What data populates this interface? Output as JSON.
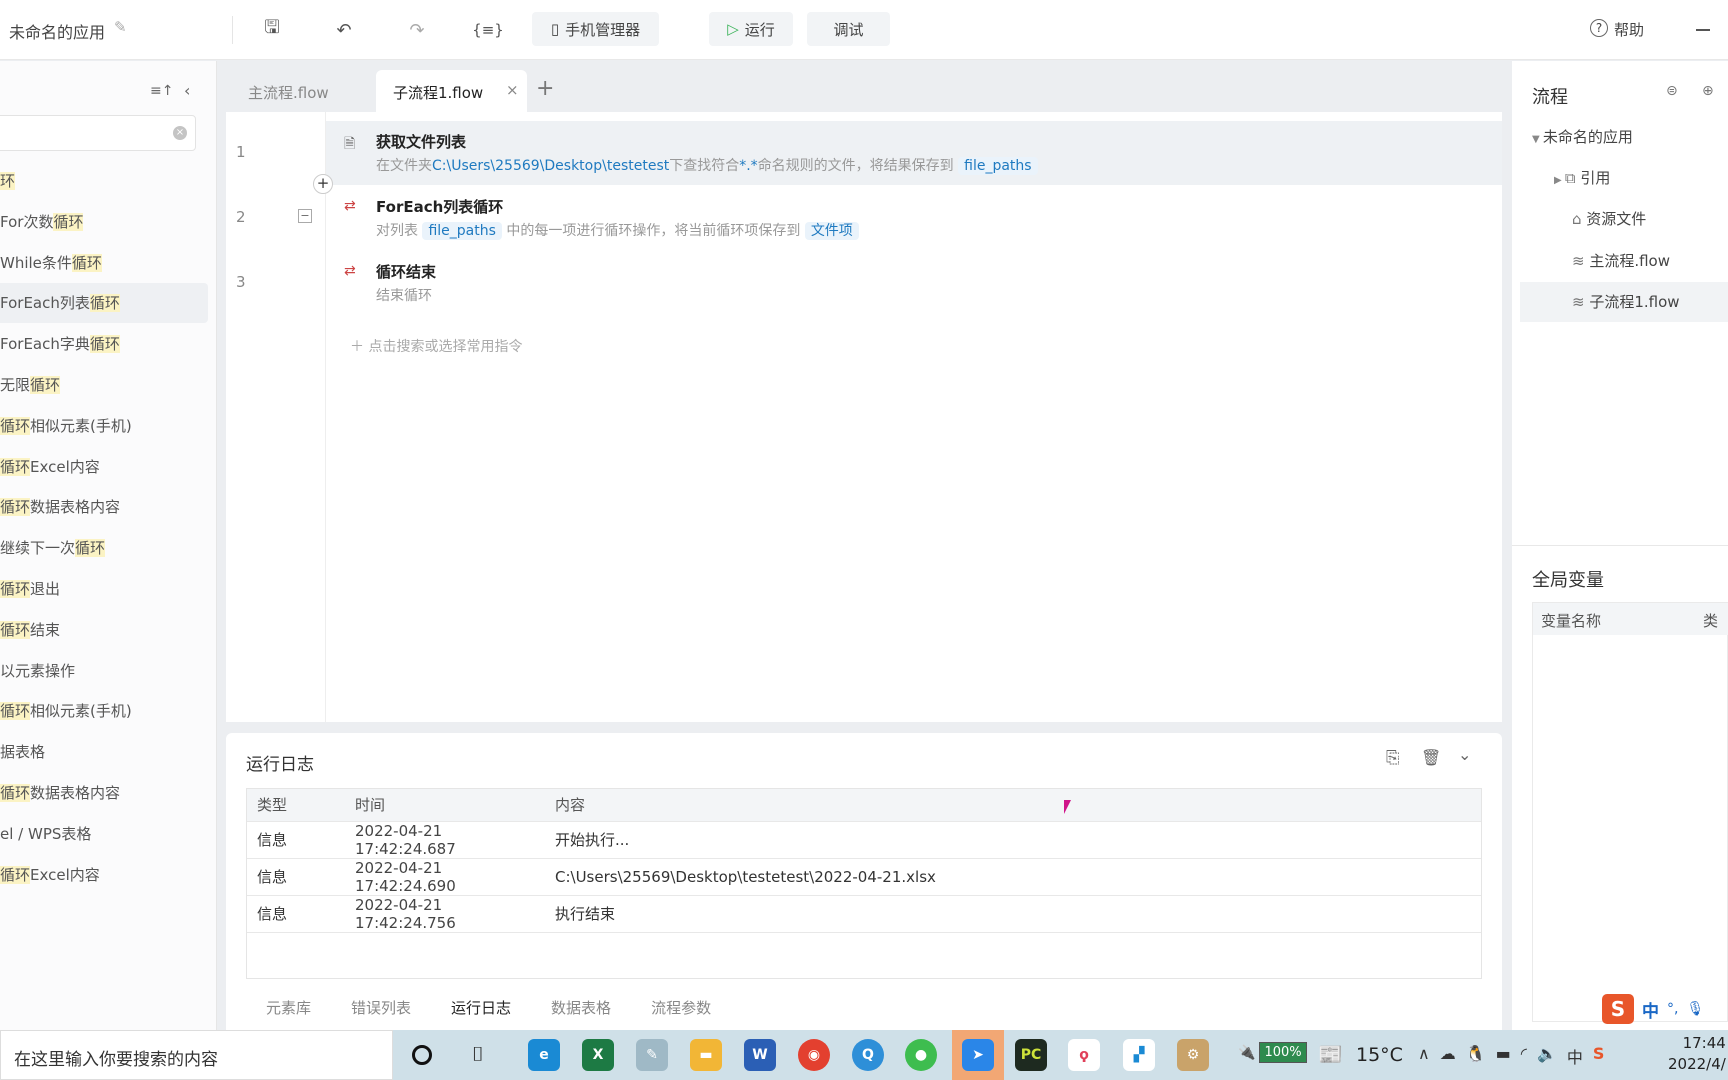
{
  "app": {
    "title": "未命名的应用"
  },
  "toolbar": {
    "phone_manager": "手机管理器",
    "run": "运行",
    "debug": "调试",
    "help": "帮助"
  },
  "left_panel": {
    "items": [
      {
        "pre": "",
        "hl": "环",
        "post": ""
      },
      {
        "pre": "For次数",
        "hl": "循环",
        "post": ""
      },
      {
        "pre": "While条件",
        "hl": "循环",
        "post": ""
      },
      {
        "pre": "ForEach列表",
        "hl": "循环",
        "post": ""
      },
      {
        "pre": "ForEach字典",
        "hl": "循环",
        "post": ""
      },
      {
        "pre": "无限",
        "hl": "循环",
        "post": ""
      },
      {
        "pre": "",
        "hl": "循环",
        "post": "相似元素(手机)"
      },
      {
        "pre": "",
        "hl": "循环",
        "post": "Excel内容"
      },
      {
        "pre": "",
        "hl": "循环",
        "post": "数据表格内容"
      },
      {
        "pre": "继续下一次",
        "hl": "循环",
        "post": ""
      },
      {
        "pre": "",
        "hl": "循环",
        "post": "退出"
      },
      {
        "pre": "",
        "hl": "循环",
        "post": "结束"
      },
      {
        "pre": "以元素操作",
        "hl": "",
        "post": ""
      },
      {
        "pre": "",
        "hl": "循环",
        "post": "相似元素(手机)"
      },
      {
        "pre": "据表格",
        "hl": "",
        "post": ""
      },
      {
        "pre": "",
        "hl": "循环",
        "post": "数据表格内容"
      },
      {
        "pre": "el / WPS表格",
        "hl": "",
        "post": ""
      },
      {
        "pre": "",
        "hl": "循环",
        "post": "Excel内容"
      }
    ]
  },
  "tabs": [
    {
      "label": "主流程.flow"
    },
    {
      "label": "子流程1.flow"
    }
  ],
  "editor": {
    "rows": [
      {
        "num": "1",
        "title": "获取文件列表",
        "d1": "在文件夹",
        "path": "C:\\Users\\25569\\Desktop\\testetest",
        "d2": "下查找符合",
        "pattern": "*.*",
        "d3": "命名规则的文件，将结果保存到",
        "var": "file_paths"
      },
      {
        "num": "2",
        "title": "ForEach列表循环",
        "d1": "对列表",
        "var": "file_paths",
        "d2": "中的每一项进行循环操作，将当前循环项保存到",
        "var2": "文件项"
      },
      {
        "num": "3",
        "title": "循环结束",
        "d1": "结束循环"
      }
    ],
    "add_hint": "点击搜索或选择常用指令"
  },
  "log": {
    "title": "运行日志",
    "columns": [
      "类型",
      "时间",
      "内容"
    ],
    "rows": [
      [
        "信息",
        "2022-04-21 17:42:24.687",
        "开始执行..."
      ],
      [
        "信息",
        "2022-04-21 17:42:24.690",
        "C:\\Users\\25569\\Desktop\\testetest\\2022-04-21.xlsx"
      ],
      [
        "信息",
        "2022-04-21 17:42:24.756",
        "执行结束"
      ]
    ],
    "bottom_tabs": [
      "元素库",
      "错误列表",
      "运行日志",
      "数据表格",
      "流程参数"
    ]
  },
  "right_panel": {
    "title": "流程",
    "tree": [
      "未命名的应用",
      "引用",
      "资源文件",
      "主流程.flow",
      "子流程1.flow"
    ],
    "globals_title": "全局变量",
    "globals_columns": [
      "变量名称",
      "类"
    ]
  },
  "ime": {
    "label": "中"
  },
  "taskbar": {
    "search_placeholder": "在这里输入你要搜索的内容",
    "battery": "100%",
    "temp": "15°C",
    "ime": "中",
    "time": "17:44",
    "date": "2022/4/"
  }
}
